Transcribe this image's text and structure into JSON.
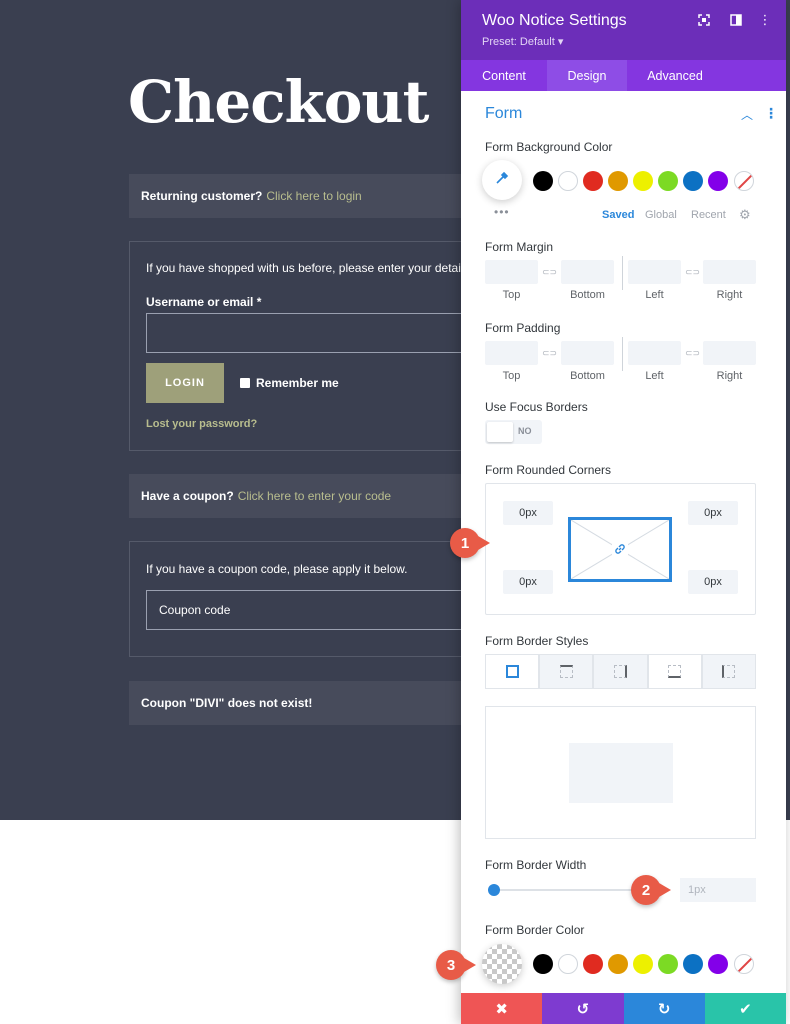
{
  "page": {
    "title": "Checkout",
    "returning_customer": {
      "text": "Returning customer?",
      "link": "Click here to login"
    },
    "login_form": {
      "intro": "If you have shopped with us before, please enter your details b",
      "username_label": "Username or email *",
      "login_button": "LOGIN",
      "remember_me": "Remember me",
      "lost_password": "Lost your password?"
    },
    "coupon_notice": {
      "text": "Have a coupon?",
      "link": "Click here to enter your code"
    },
    "coupon_form": {
      "intro": "If you have a coupon code, please apply it below.",
      "placeholder": "Coupon code"
    },
    "error_notice": "Coupon \"DIVI\" does not exist!"
  },
  "panel": {
    "title": "Woo Notice Settings",
    "preset": "Preset: Default ▾",
    "tabs": [
      "Content",
      "Design",
      "Advanced"
    ],
    "active_tab": "Design",
    "section": "Form",
    "bg_color_label": "Form Background Color",
    "palette_tabs": [
      "Saved",
      "Global",
      "Recent"
    ],
    "swatch_colors": [
      "#000000",
      "#ffffff",
      "#e02b20",
      "#e09900",
      "#edf000",
      "#7cda24",
      "#0c71c3",
      "#8300e9"
    ],
    "margin_label": "Form Margin",
    "padding_label": "Form Padding",
    "spacing_labels": [
      "Top",
      "Bottom",
      "Left",
      "Right"
    ],
    "focus_borders_label": "Use Focus Borders",
    "focus_borders_value": "NO",
    "rounded_corners_label": "Form Rounded Corners",
    "corner_values": [
      "0px",
      "0px",
      "0px",
      "0px"
    ],
    "border_styles_label": "Form Border Styles",
    "border_width_label": "Form Border Width",
    "border_width_value": "1px",
    "border_color_label": "Form Border Color"
  },
  "badges": [
    "1",
    "2",
    "3"
  ],
  "colors": {
    "accent": "#2b87da",
    "header": "#6c2eb9",
    "tabs": "#8436e0",
    "cancel": "#ef5555",
    "undo": "#7e3bd0",
    "redo": "#2b87da",
    "save": "#29c4a9",
    "badge": "#e85b47"
  },
  "icons": [
    "fullscreen-icon",
    "split-view-icon",
    "more-vertical-icon",
    "eyedropper-icon",
    "link-icon",
    "close-icon",
    "undo-icon",
    "redo-icon",
    "check-icon"
  ]
}
